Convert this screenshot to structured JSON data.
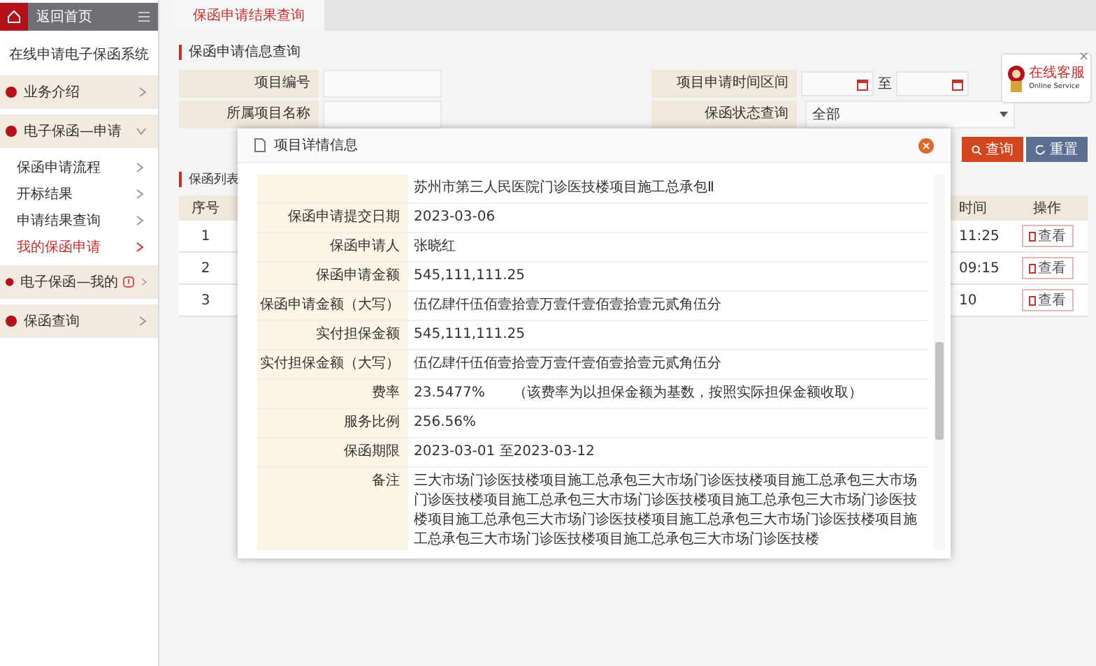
{
  "sidebar": {
    "header": "返回首页",
    "system_title": "在线申请电子保函系统",
    "groups": [
      {
        "label": "业务介绍",
        "expanded": false,
        "notice": false
      },
      {
        "label": "电子保函—申请",
        "expanded": true,
        "notice": false,
        "children": [
          {
            "label": "保函申请流程",
            "selected": false
          },
          {
            "label": "开标结果",
            "selected": false
          },
          {
            "label": "申请结果查询",
            "selected": false
          },
          {
            "label": "我的保函申请",
            "selected": true
          }
        ]
      },
      {
        "label": "电子保函—我的",
        "expanded": false,
        "notice": true
      },
      {
        "label": "保函查询",
        "expanded": false,
        "notice": false
      }
    ]
  },
  "tabs": [
    {
      "label": "保函申请结果查询",
      "selected": true
    }
  ],
  "search": {
    "title": "保函申请信息查询",
    "fields": [
      {
        "kind": "text",
        "label": "项目编号"
      },
      {
        "kind": "daterange",
        "label": "项目申请时间区间",
        "separator": "至"
      },
      {
        "kind": "text",
        "label": "所属项目名称"
      },
      {
        "kind": "select",
        "label": "保函状态查询",
        "value": "全部"
      }
    ],
    "buttons": [
      {
        "kind": "search",
        "label": "查询"
      },
      {
        "kind": "reset",
        "label": "重置"
      }
    ]
  },
  "service": {
    "title": "在线客服",
    "subtitle": "Online Service",
    "close": "×"
  },
  "table": {
    "title": "保函列表",
    "columns": [
      "序号",
      "时间",
      "操作"
    ],
    "rows": [
      {
        "index": "1",
        "time": "11:25",
        "action": "查看"
      },
      {
        "index": "2",
        "time": "09:15",
        "action": "查看"
      },
      {
        "index": "3",
        "time": "10",
        "action": "查看"
      }
    ]
  },
  "modal": {
    "title": "项目详情信息",
    "rows": [
      {
        "label": "",
        "value": "苏州市第三人民医院门诊医技楼项目施工总承包Ⅱ"
      },
      {
        "label": "保函申请提交日期",
        "value": "2023-03-06"
      },
      {
        "label": "保函申请人",
        "value": "张晓红"
      },
      {
        "label": "保函申请金额",
        "value": "545,111,111.25"
      },
      {
        "label": "保函申请金额（大写）",
        "value": "伍亿肆仟伍佰壹拾壹万壹仟壹佰壹拾壹元贰角伍分"
      },
      {
        "label": "实付担保金额",
        "value": "545,111,111.25"
      },
      {
        "label": "实付担保金额（大写）",
        "value": "伍亿肆仟伍佰壹拾壹万壹仟壹佰壹拾壹元贰角伍分"
      },
      {
        "label": "费率",
        "value": "23.5477%",
        "note": "（该费率为以担保金额为基数，按照实际担保金额收取）"
      },
      {
        "label": "服务比例",
        "value": "256.56%"
      },
      {
        "label": "保函期限",
        "value": "2023-03-01 至2023-03-12"
      },
      {
        "label": "备注",
        "value": "三大市场门诊医技楼项目施工总承包三大市场门诊医技楼项目施工总承包三大市场门诊医技楼项目施工总承包三大市场门诊医技楼项目施工总承包三大市场门诊医技楼项目施工总承包三大市场门诊医技楼项目施工总承包三大市场门诊医技楼项目施工总承包三大市场门诊医技楼项目施工总承包三大市场门诊医技楼"
      }
    ]
  }
}
